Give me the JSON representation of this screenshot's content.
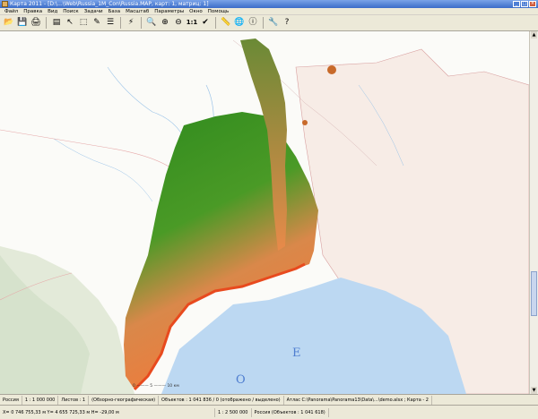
{
  "window": {
    "title": "Карта 2011 - [D:\\...\\Web\\Russia_1M_Con\\Russia.MAP, карт: 1, матриц: 1]",
    "minimize": "_",
    "maximize": "□",
    "close": "×"
  },
  "menu": [
    "Файл",
    "Правка",
    "Вид",
    "Поиск",
    "Задачи",
    "База",
    "Масштаб",
    "Параметры",
    "Окно",
    "Помощь"
  ],
  "toolbar": {
    "buttons": [
      {
        "name": "open-folder-icon",
        "glyph": "📂"
      },
      {
        "name": "save-icon",
        "glyph": "💾"
      },
      {
        "name": "print-icon",
        "glyph": "🖨"
      },
      {
        "name": "layers-icon",
        "glyph": "▤"
      },
      {
        "name": "pointer-icon",
        "glyph": "↖"
      },
      {
        "name": "select-icon",
        "glyph": "⬚"
      },
      {
        "name": "edit-icon",
        "glyph": "✎"
      },
      {
        "name": "list-icon",
        "glyph": "☰"
      },
      {
        "name": "lightning-icon",
        "glyph": "⚡"
      },
      {
        "name": "zoom-icon",
        "glyph": "🔍"
      },
      {
        "name": "zoom-in-icon",
        "glyph": "⊕"
      },
      {
        "name": "zoom-out-icon",
        "glyph": "⊖"
      },
      {
        "name": "check-icon",
        "glyph": "✔"
      },
      {
        "name": "ruler-icon",
        "glyph": "📏"
      },
      {
        "name": "globe-icon",
        "glyph": "🌐"
      },
      {
        "name": "info-icon",
        "glyph": "ⓘ"
      },
      {
        "name": "tools-icon",
        "glyph": "🔧"
      },
      {
        "name": "help-icon",
        "glyph": "?"
      }
    ],
    "scale_label": "1:1"
  },
  "map": {
    "letter_o": "О",
    "letter_e": "Е",
    "scalebar": "0 ——— 5 ——— 10 км"
  },
  "status1": [
    "Россия",
    "1 : 1 000 000",
    "Листов : 1",
    "(Обзорно-географическая)",
    "Объектов : 1 041 836 / 0 (отображено / выделено)",
    "Атлас C:\\Panorama\\Panorama13\\Data\\...\\demo.alsx ; Карта - 2"
  ],
  "status2": [
    "X= 0 746 755,33 м  Y= 4 655 725,33 м  H= -29,00 м",
    "1 : 2 500 000",
    "Россия  (Объектов : 1 041 618)"
  ],
  "colors": {
    "land": "#f7ede6",
    "sea": "#bcd8f2",
    "terrain_high": "#2f8a1e",
    "terrain_low": "#f07a3a",
    "coast": "#e84a1e"
  }
}
